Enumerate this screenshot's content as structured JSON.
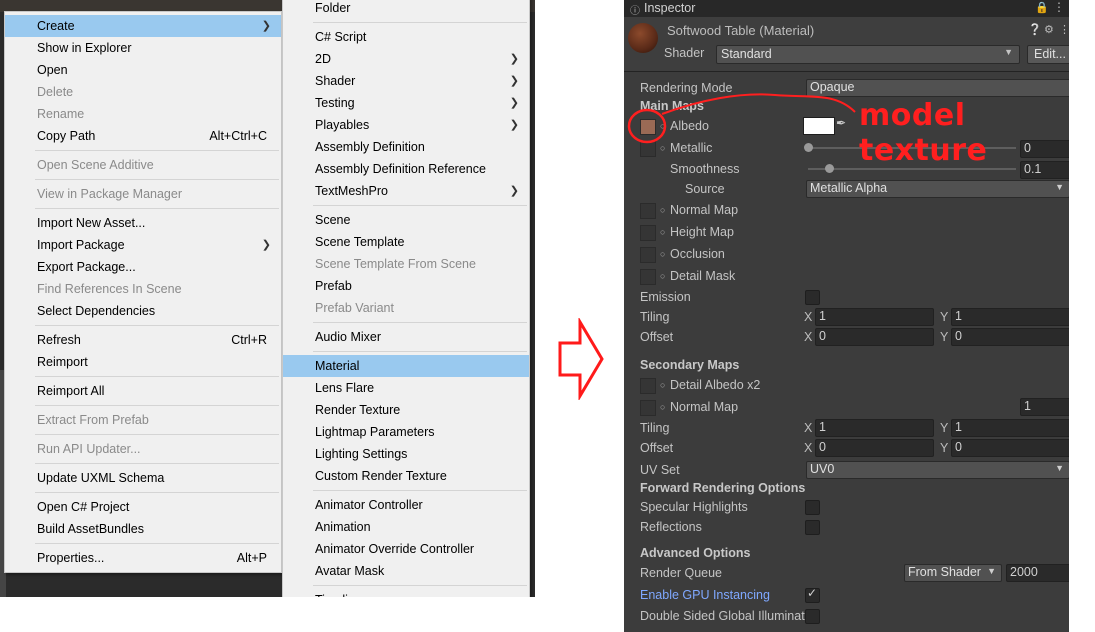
{
  "create_menu": {
    "items": [
      {
        "label": "Create",
        "shortcut": "",
        "submenu": true,
        "disabled": false,
        "selected": true
      },
      {
        "label": "Show in Explorer",
        "shortcut": "",
        "submenu": false,
        "disabled": false
      },
      {
        "label": "Open",
        "shortcut": "",
        "submenu": false,
        "disabled": false
      },
      {
        "label": "Delete",
        "shortcut": "",
        "submenu": false,
        "disabled": true
      },
      {
        "label": "Rename",
        "shortcut": "",
        "submenu": false,
        "disabled": true
      },
      {
        "label": "Copy Path",
        "shortcut": "Alt+Ctrl+C",
        "submenu": false,
        "disabled": false
      },
      {
        "label": "Open Scene Additive",
        "shortcut": "",
        "submenu": false,
        "disabled": true
      },
      {
        "label": "View in Package Manager",
        "shortcut": "",
        "submenu": false,
        "disabled": true
      },
      {
        "label": "Import New Asset...",
        "shortcut": "",
        "submenu": false,
        "disabled": false
      },
      {
        "label": "Import Package",
        "shortcut": "",
        "submenu": true,
        "disabled": false
      },
      {
        "label": "Export Package...",
        "shortcut": "",
        "submenu": false,
        "disabled": false
      },
      {
        "label": "Find References In Scene",
        "shortcut": "",
        "submenu": false,
        "disabled": true
      },
      {
        "label": "Select Dependencies",
        "shortcut": "",
        "submenu": false,
        "disabled": false
      },
      {
        "label": "Refresh",
        "shortcut": "Ctrl+R",
        "submenu": false,
        "disabled": false
      },
      {
        "label": "Reimport",
        "shortcut": "",
        "submenu": false,
        "disabled": false
      },
      {
        "label": "Reimport All",
        "shortcut": "",
        "submenu": false,
        "disabled": false
      },
      {
        "label": "Extract From Prefab",
        "shortcut": "",
        "submenu": false,
        "disabled": true
      },
      {
        "label": "Run API Updater...",
        "shortcut": "",
        "submenu": false,
        "disabled": true
      },
      {
        "label": "Update UXML Schema",
        "shortcut": "",
        "submenu": false,
        "disabled": false
      },
      {
        "label": "Open C# Project",
        "shortcut": "",
        "submenu": false,
        "disabled": false
      },
      {
        "label": "Build AssetBundles",
        "shortcut": "",
        "submenu": false,
        "disabled": false
      },
      {
        "label": "Properties...",
        "shortcut": "Alt+P",
        "submenu": false,
        "disabled": false
      }
    ]
  },
  "create_submenu": {
    "items": [
      {
        "label": "Folder",
        "submenu": false,
        "disabled": false
      },
      {
        "label": "C# Script",
        "submenu": false,
        "disabled": false
      },
      {
        "label": "2D",
        "submenu": true,
        "disabled": false
      },
      {
        "label": "Shader",
        "submenu": true,
        "disabled": false
      },
      {
        "label": "Testing",
        "submenu": true,
        "disabled": false
      },
      {
        "label": "Playables",
        "submenu": true,
        "disabled": false
      },
      {
        "label": "Assembly Definition",
        "submenu": false,
        "disabled": false
      },
      {
        "label": "Assembly Definition Reference",
        "submenu": false,
        "disabled": false
      },
      {
        "label": "TextMeshPro",
        "submenu": true,
        "disabled": false
      },
      {
        "label": "Scene",
        "submenu": false,
        "disabled": false
      },
      {
        "label": "Scene Template",
        "submenu": false,
        "disabled": false
      },
      {
        "label": "Scene Template From Scene",
        "submenu": false,
        "disabled": true
      },
      {
        "label": "Prefab",
        "submenu": false,
        "disabled": false
      },
      {
        "label": "Prefab Variant",
        "submenu": false,
        "disabled": true
      },
      {
        "label": "Audio Mixer",
        "submenu": false,
        "disabled": false
      },
      {
        "label": "Material",
        "submenu": false,
        "disabled": false,
        "selected": true
      },
      {
        "label": "Lens Flare",
        "submenu": false,
        "disabled": false
      },
      {
        "label": "Render Texture",
        "submenu": false,
        "disabled": false
      },
      {
        "label": "Lightmap Parameters",
        "submenu": false,
        "disabled": false
      },
      {
        "label": "Lighting Settings",
        "submenu": false,
        "disabled": false
      },
      {
        "label": "Custom Render Texture",
        "submenu": false,
        "disabled": false
      },
      {
        "label": "Animator Controller",
        "submenu": false,
        "disabled": false
      },
      {
        "label": "Animation",
        "submenu": false,
        "disabled": false
      },
      {
        "label": "Animator Override Controller",
        "submenu": false,
        "disabled": false
      },
      {
        "label": "Avatar Mask",
        "submenu": false,
        "disabled": false
      },
      {
        "label": "Timeline",
        "submenu": false,
        "disabled": false
      }
    ]
  },
  "inspector": {
    "tab": "Inspector",
    "title": "Softwood Table (Material)",
    "shader_label": "Shader",
    "shader_value": "Standard",
    "edit_label": "Edit...",
    "rendering_mode_label": "Rendering Mode",
    "rendering_mode_value": "Opaque",
    "main_maps": "Main Maps",
    "albedo": "Albedo",
    "metallic": "Metallic",
    "metallic_value": "0",
    "smoothness": "Smoothness",
    "smoothness_value": "0.1",
    "source": "Source",
    "source_value": "Metallic Alpha",
    "normal_map": "Normal Map",
    "height_map": "Height Map",
    "occlusion": "Occlusion",
    "detail_mask": "Detail Mask",
    "emission": "Emission",
    "tiling": "Tiling",
    "offset": "Offset",
    "x": "X",
    "y": "Y",
    "tiling_x": "1",
    "tiling_y": "1",
    "offset_x": "0",
    "offset_y": "0",
    "secondary_maps": "Secondary Maps",
    "detail_albedo": "Detail Albedo x2",
    "normal_map_2": "Normal Map",
    "normal_map_2_value": "1",
    "tiling2_x": "1",
    "tiling2_y": "1",
    "offset2_x": "0",
    "offset2_y": "0",
    "uv_set": "UV Set",
    "uv_set_value": "UV0",
    "forward_options": "Forward Rendering Options",
    "specular": "Specular Highlights",
    "reflections": "Reflections",
    "advanced": "Advanced Options",
    "render_queue": "Render Queue",
    "render_queue_mode": "From Shader",
    "render_queue_value": "2000",
    "gpu_instancing": "Enable GPU Instancing",
    "double_sided": "Double Sided Global Illuminat",
    "colors": {
      "bg": "#3c3c3c",
      "accent_link": "#7fa8ff"
    }
  },
  "annotation": {
    "text": "model texture",
    "color": "#ff1f1f"
  }
}
